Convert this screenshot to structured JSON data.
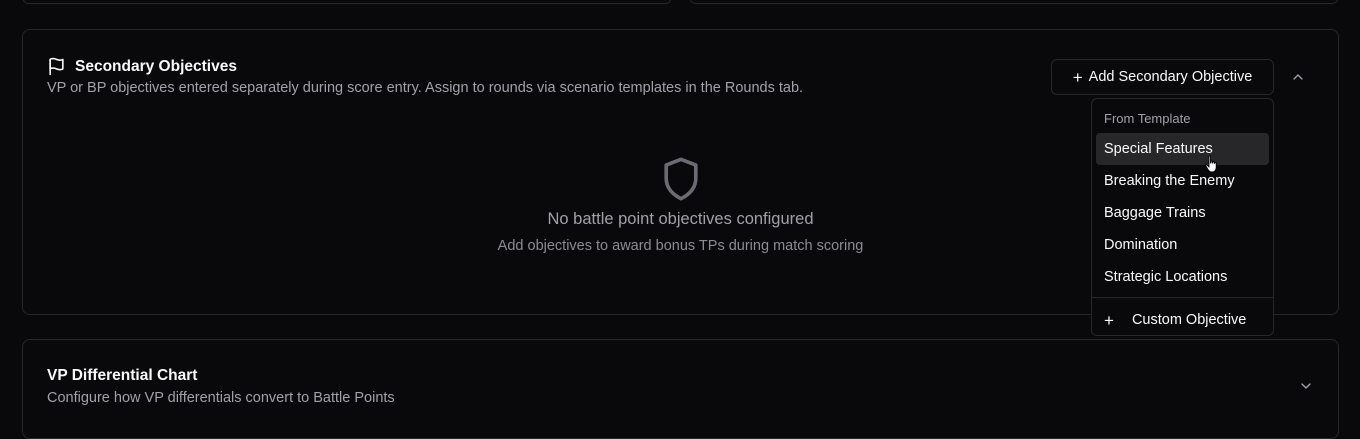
{
  "secondary": {
    "title": "Secondary Objectives",
    "description": "VP or BP objectives entered separately during score entry. Assign to rounds via scenario templates in the Rounds tab.",
    "add_button_label": "Add Secondary Objective",
    "empty_title": "No battle point objectives configured",
    "empty_subtitle": "Add objectives to award bonus TPs during match scoring"
  },
  "dropdown": {
    "group_label": "From Template",
    "items": [
      {
        "label": "Special Features"
      },
      {
        "label": "Breaking the Enemy"
      },
      {
        "label": "Baggage Trains"
      },
      {
        "label": "Domination"
      },
      {
        "label": "Strategic Locations"
      }
    ],
    "custom_label": "Custom Objective"
  },
  "vp_chart": {
    "title": "VP Differential Chart",
    "description": "Configure how VP differentials convert to Battle Points"
  },
  "icons": {
    "flag": "flag-icon",
    "plus": "plus-icon",
    "shield": "shield-icon",
    "chevron_up": "chevron-up-icon",
    "chevron_down": "chevron-down-icon",
    "cursor": "hand-pointer-icon"
  }
}
